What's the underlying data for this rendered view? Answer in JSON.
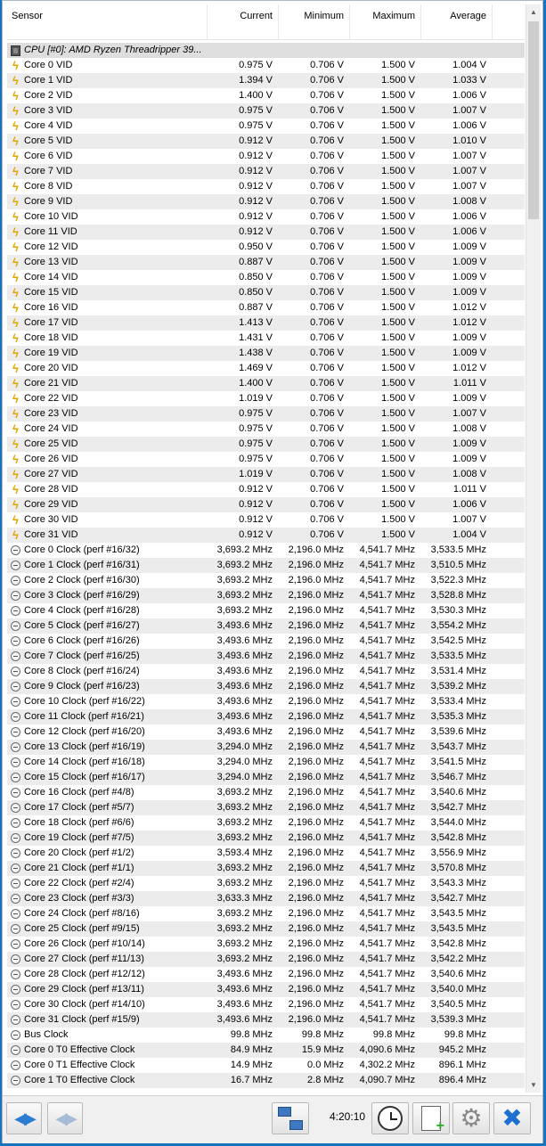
{
  "columns": {
    "sensor": "Sensor",
    "current": "Current",
    "minimum": "Minimum",
    "maximum": "Maximum",
    "average": "Average"
  },
  "group": {
    "label": "CPU [#0]: AMD Ryzen Threadripper 39...",
    "icon": "chip-icon"
  },
  "rows": [
    {
      "icon": "bolt",
      "name": "Core 0 VID",
      "cur": "0.975 V",
      "min": "0.706 V",
      "max": "1.500 V",
      "avg": "1.004 V"
    },
    {
      "icon": "bolt",
      "name": "Core 1 VID",
      "cur": "1.394 V",
      "min": "0.706 V",
      "max": "1.500 V",
      "avg": "1.033 V"
    },
    {
      "icon": "bolt",
      "name": "Core 2 VID",
      "cur": "1.400 V",
      "min": "0.706 V",
      "max": "1.500 V",
      "avg": "1.006 V"
    },
    {
      "icon": "bolt",
      "name": "Core 3 VID",
      "cur": "0.975 V",
      "min": "0.706 V",
      "max": "1.500 V",
      "avg": "1.007 V"
    },
    {
      "icon": "bolt",
      "name": "Core 4 VID",
      "cur": "0.975 V",
      "min": "0.706 V",
      "max": "1.500 V",
      "avg": "1.006 V"
    },
    {
      "icon": "bolt",
      "name": "Core 5 VID",
      "cur": "0.912 V",
      "min": "0.706 V",
      "max": "1.500 V",
      "avg": "1.010 V"
    },
    {
      "icon": "bolt",
      "name": "Core 6 VID",
      "cur": "0.912 V",
      "min": "0.706 V",
      "max": "1.500 V",
      "avg": "1.007 V"
    },
    {
      "icon": "bolt",
      "name": "Core 7 VID",
      "cur": "0.912 V",
      "min": "0.706 V",
      "max": "1.500 V",
      "avg": "1.007 V"
    },
    {
      "icon": "bolt",
      "name": "Core 8 VID",
      "cur": "0.912 V",
      "min": "0.706 V",
      "max": "1.500 V",
      "avg": "1.007 V"
    },
    {
      "icon": "bolt",
      "name": "Core 9 VID",
      "cur": "0.912 V",
      "min": "0.706 V",
      "max": "1.500 V",
      "avg": "1.008 V"
    },
    {
      "icon": "bolt",
      "name": "Core 10 VID",
      "cur": "0.912 V",
      "min": "0.706 V",
      "max": "1.500 V",
      "avg": "1.006 V"
    },
    {
      "icon": "bolt",
      "name": "Core 11 VID",
      "cur": "0.912 V",
      "min": "0.706 V",
      "max": "1.500 V",
      "avg": "1.006 V"
    },
    {
      "icon": "bolt",
      "name": "Core 12 VID",
      "cur": "0.950 V",
      "min": "0.706 V",
      "max": "1.500 V",
      "avg": "1.009 V"
    },
    {
      "icon": "bolt",
      "name": "Core 13 VID",
      "cur": "0.887 V",
      "min": "0.706 V",
      "max": "1.500 V",
      "avg": "1.009 V"
    },
    {
      "icon": "bolt",
      "name": "Core 14 VID",
      "cur": "0.850 V",
      "min": "0.706 V",
      "max": "1.500 V",
      "avg": "1.009 V"
    },
    {
      "icon": "bolt",
      "name": "Core 15 VID",
      "cur": "0.850 V",
      "min": "0.706 V",
      "max": "1.500 V",
      "avg": "1.009 V"
    },
    {
      "icon": "bolt",
      "name": "Core 16 VID",
      "cur": "0.887 V",
      "min": "0.706 V",
      "max": "1.500 V",
      "avg": "1.012 V"
    },
    {
      "icon": "bolt",
      "name": "Core 17 VID",
      "cur": "1.413 V",
      "min": "0.706 V",
      "max": "1.500 V",
      "avg": "1.012 V"
    },
    {
      "icon": "bolt",
      "name": "Core 18 VID",
      "cur": "1.431 V",
      "min": "0.706 V",
      "max": "1.500 V",
      "avg": "1.009 V"
    },
    {
      "icon": "bolt",
      "name": "Core 19 VID",
      "cur": "1.438 V",
      "min": "0.706 V",
      "max": "1.500 V",
      "avg": "1.009 V"
    },
    {
      "icon": "bolt",
      "name": "Core 20 VID",
      "cur": "1.469 V",
      "min": "0.706 V",
      "max": "1.500 V",
      "avg": "1.012 V"
    },
    {
      "icon": "bolt",
      "name": "Core 21 VID",
      "cur": "1.400 V",
      "min": "0.706 V",
      "max": "1.500 V",
      "avg": "1.011 V"
    },
    {
      "icon": "bolt",
      "name": "Core 22 VID",
      "cur": "1.019 V",
      "min": "0.706 V",
      "max": "1.500 V",
      "avg": "1.009 V"
    },
    {
      "icon": "bolt",
      "name": "Core 23 VID",
      "cur": "0.975 V",
      "min": "0.706 V",
      "max": "1.500 V",
      "avg": "1.007 V"
    },
    {
      "icon": "bolt",
      "name": "Core 24 VID",
      "cur": "0.975 V",
      "min": "0.706 V",
      "max": "1.500 V",
      "avg": "1.008 V"
    },
    {
      "icon": "bolt",
      "name": "Core 25 VID",
      "cur": "0.975 V",
      "min": "0.706 V",
      "max": "1.500 V",
      "avg": "1.009 V"
    },
    {
      "icon": "bolt",
      "name": "Core 26 VID",
      "cur": "0.975 V",
      "min": "0.706 V",
      "max": "1.500 V",
      "avg": "1.009 V"
    },
    {
      "icon": "bolt",
      "name": "Core 27 VID",
      "cur": "1.019 V",
      "min": "0.706 V",
      "max": "1.500 V",
      "avg": "1.008 V"
    },
    {
      "icon": "bolt",
      "name": "Core 28 VID",
      "cur": "0.912 V",
      "min": "0.706 V",
      "max": "1.500 V",
      "avg": "1.011 V"
    },
    {
      "icon": "bolt",
      "name": "Core 29 VID",
      "cur": "0.912 V",
      "min": "0.706 V",
      "max": "1.500 V",
      "avg": "1.006 V"
    },
    {
      "icon": "bolt",
      "name": "Core 30 VID",
      "cur": "0.912 V",
      "min": "0.706 V",
      "max": "1.500 V",
      "avg": "1.007 V"
    },
    {
      "icon": "bolt",
      "name": "Core 31 VID",
      "cur": "0.912 V",
      "min": "0.706 V",
      "max": "1.500 V",
      "avg": "1.004 V"
    },
    {
      "icon": "clock",
      "name": "Core 0 Clock (perf #16/32)",
      "cur": "3,693.2 MHz",
      "min": "2,196.0 MHz",
      "max": "4,541.7 MHz",
      "avg": "3,533.5 MHz"
    },
    {
      "icon": "clock",
      "name": "Core 1 Clock (perf #16/31)",
      "cur": "3,693.2 MHz",
      "min": "2,196.0 MHz",
      "max": "4,541.7 MHz",
      "avg": "3,510.5 MHz"
    },
    {
      "icon": "clock",
      "name": "Core 2 Clock (perf #16/30)",
      "cur": "3,693.2 MHz",
      "min": "2,196.0 MHz",
      "max": "4,541.7 MHz",
      "avg": "3,522.3 MHz"
    },
    {
      "icon": "clock",
      "name": "Core 3 Clock (perf #16/29)",
      "cur": "3,693.2 MHz",
      "min": "2,196.0 MHz",
      "max": "4,541.7 MHz",
      "avg": "3,528.8 MHz"
    },
    {
      "icon": "clock",
      "name": "Core 4 Clock (perf #16/28)",
      "cur": "3,693.2 MHz",
      "min": "2,196.0 MHz",
      "max": "4,541.7 MHz",
      "avg": "3,530.3 MHz"
    },
    {
      "icon": "clock",
      "name": "Core 5 Clock (perf #16/27)",
      "cur": "3,493.6 MHz",
      "min": "2,196.0 MHz",
      "max": "4,541.7 MHz",
      "avg": "3,554.2 MHz"
    },
    {
      "icon": "clock",
      "name": "Core 6 Clock (perf #16/26)",
      "cur": "3,493.6 MHz",
      "min": "2,196.0 MHz",
      "max": "4,541.7 MHz",
      "avg": "3,542.5 MHz"
    },
    {
      "icon": "clock",
      "name": "Core 7 Clock (perf #16/25)",
      "cur": "3,493.6 MHz",
      "min": "2,196.0 MHz",
      "max": "4,541.7 MHz",
      "avg": "3,533.5 MHz"
    },
    {
      "icon": "clock",
      "name": "Core 8 Clock (perf #16/24)",
      "cur": "3,493.6 MHz",
      "min": "2,196.0 MHz",
      "max": "4,541.7 MHz",
      "avg": "3,531.4 MHz"
    },
    {
      "icon": "clock",
      "name": "Core 9 Clock (perf #16/23)",
      "cur": "3,493.6 MHz",
      "min": "2,196.0 MHz",
      "max": "4,541.7 MHz",
      "avg": "3,539.2 MHz"
    },
    {
      "icon": "clock",
      "name": "Core 10 Clock (perf #16/22)",
      "cur": "3,493.6 MHz",
      "min": "2,196.0 MHz",
      "max": "4,541.7 MHz",
      "avg": "3,533.4 MHz"
    },
    {
      "icon": "clock",
      "name": "Core 11 Clock (perf #16/21)",
      "cur": "3,493.6 MHz",
      "min": "2,196.0 MHz",
      "max": "4,541.7 MHz",
      "avg": "3,535.3 MHz"
    },
    {
      "icon": "clock",
      "name": "Core 12 Clock (perf #16/20)",
      "cur": "3,493.6 MHz",
      "min": "2,196.0 MHz",
      "max": "4,541.7 MHz",
      "avg": "3,539.6 MHz"
    },
    {
      "icon": "clock",
      "name": "Core 13 Clock (perf #16/19)",
      "cur": "3,294.0 MHz",
      "min": "2,196.0 MHz",
      "max": "4,541.7 MHz",
      "avg": "3,543.7 MHz"
    },
    {
      "icon": "clock",
      "name": "Core 14 Clock (perf #16/18)",
      "cur": "3,294.0 MHz",
      "min": "2,196.0 MHz",
      "max": "4,541.7 MHz",
      "avg": "3,541.5 MHz"
    },
    {
      "icon": "clock",
      "name": "Core 15 Clock (perf #16/17)",
      "cur": "3,294.0 MHz",
      "min": "2,196.0 MHz",
      "max": "4,541.7 MHz",
      "avg": "3,546.7 MHz"
    },
    {
      "icon": "clock",
      "name": "Core 16 Clock (perf #4/8)",
      "cur": "3,693.2 MHz",
      "min": "2,196.0 MHz",
      "max": "4,541.7 MHz",
      "avg": "3,540.6 MHz"
    },
    {
      "icon": "clock",
      "name": "Core 17 Clock (perf #5/7)",
      "cur": "3,693.2 MHz",
      "min": "2,196.0 MHz",
      "max": "4,541.7 MHz",
      "avg": "3,542.7 MHz"
    },
    {
      "icon": "clock",
      "name": "Core 18 Clock (perf #6/6)",
      "cur": "3,693.2 MHz",
      "min": "2,196.0 MHz",
      "max": "4,541.7 MHz",
      "avg": "3,544.0 MHz"
    },
    {
      "icon": "clock",
      "name": "Core 19 Clock (perf #7/5)",
      "cur": "3,693.2 MHz",
      "min": "2,196.0 MHz",
      "max": "4,541.7 MHz",
      "avg": "3,542.8 MHz"
    },
    {
      "icon": "clock",
      "name": "Core 20 Clock (perf #1/2)",
      "cur": "3,593.4 MHz",
      "min": "2,196.0 MHz",
      "max": "4,541.7 MHz",
      "avg": "3,556.9 MHz"
    },
    {
      "icon": "clock",
      "name": "Core 21 Clock (perf #1/1)",
      "cur": "3,693.2 MHz",
      "min": "2,196.0 MHz",
      "max": "4,541.7 MHz",
      "avg": "3,570.8 MHz"
    },
    {
      "icon": "clock",
      "name": "Core 22 Clock (perf #2/4)",
      "cur": "3,693.2 MHz",
      "min": "2,196.0 MHz",
      "max": "4,541.7 MHz",
      "avg": "3,543.3 MHz"
    },
    {
      "icon": "clock",
      "name": "Core 23 Clock (perf #3/3)",
      "cur": "3,633.3 MHz",
      "min": "2,196.0 MHz",
      "max": "4,541.7 MHz",
      "avg": "3,542.7 MHz"
    },
    {
      "icon": "clock",
      "name": "Core 24 Clock (perf #8/16)",
      "cur": "3,693.2 MHz",
      "min": "2,196.0 MHz",
      "max": "4,541.7 MHz",
      "avg": "3,543.5 MHz"
    },
    {
      "icon": "clock",
      "name": "Core 25 Clock (perf #9/15)",
      "cur": "3,693.2 MHz",
      "min": "2,196.0 MHz",
      "max": "4,541.7 MHz",
      "avg": "3,543.5 MHz"
    },
    {
      "icon": "clock",
      "name": "Core 26 Clock (perf #10/14)",
      "cur": "3,693.2 MHz",
      "min": "2,196.0 MHz",
      "max": "4,541.7 MHz",
      "avg": "3,542.8 MHz"
    },
    {
      "icon": "clock",
      "name": "Core 27 Clock (perf #11/13)",
      "cur": "3,693.2 MHz",
      "min": "2,196.0 MHz",
      "max": "4,541.7 MHz",
      "avg": "3,542.2 MHz"
    },
    {
      "icon": "clock",
      "name": "Core 28 Clock (perf #12/12)",
      "cur": "3,493.6 MHz",
      "min": "2,196.0 MHz",
      "max": "4,541.7 MHz",
      "avg": "3,540.6 MHz"
    },
    {
      "icon": "clock",
      "name": "Core 29 Clock (perf #13/11)",
      "cur": "3,493.6 MHz",
      "min": "2,196.0 MHz",
      "max": "4,541.7 MHz",
      "avg": "3,540.0 MHz"
    },
    {
      "icon": "clock",
      "name": "Core 30 Clock (perf #14/10)",
      "cur": "3,493.6 MHz",
      "min": "2,196.0 MHz",
      "max": "4,541.7 MHz",
      "avg": "3,540.5 MHz"
    },
    {
      "icon": "clock",
      "name": "Core 31 Clock (perf #15/9)",
      "cur": "3,493.6 MHz",
      "min": "2,196.0 MHz",
      "max": "4,541.7 MHz",
      "avg": "3,539.3 MHz"
    },
    {
      "icon": "clock",
      "name": "Bus Clock",
      "cur": "99.8 MHz",
      "min": "99.8 MHz",
      "max": "99.8 MHz",
      "avg": "99.8 MHz"
    },
    {
      "icon": "clock",
      "name": "Core 0 T0 Effective Clock",
      "cur": "84.9 MHz",
      "min": "15.9 MHz",
      "max": "4,090.6 MHz",
      "avg": "945.2 MHz"
    },
    {
      "icon": "clock",
      "name": "Core 0 T1 Effective Clock",
      "cur": "14.9 MHz",
      "min": "0.0 MHz",
      "max": "4,302.2 MHz",
      "avg": "896.1 MHz"
    },
    {
      "icon": "clock",
      "name": "Core 1 T0 Effective Clock",
      "cur": "16.7 MHz",
      "min": "2.8 MHz",
      "max": "4,090.7 MHz",
      "avg": "896.4 MHz"
    }
  ],
  "toolbar": {
    "nav_left": "left-right-arrows-icon",
    "nav_left_dim": "left-right-arrows-disabled-icon",
    "network": "network-icon",
    "elapsed": "4:20:10",
    "clock": "clock-icon",
    "report": "report-add-icon",
    "settings": "gear-icon",
    "close": "close-icon"
  },
  "colors": {
    "accent": "#1d6fd0",
    "row_alt": "#ececec",
    "frame": "#1b72b8"
  }
}
